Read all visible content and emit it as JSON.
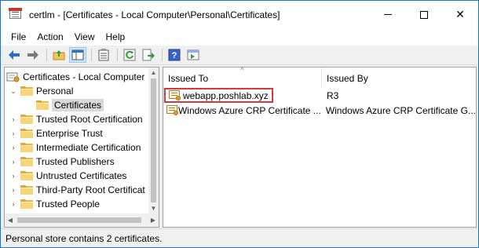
{
  "window": {
    "title": "certlm - [Certificates - Local Computer\\Personal\\Certificates]",
    "controls": {
      "minimize": "",
      "maximize": "",
      "close": "✕"
    }
  },
  "menu": {
    "items": [
      "File",
      "Action",
      "View",
      "Help"
    ]
  },
  "toolbar": {
    "buttons": [
      "back-arrow-icon",
      "forward-arrow-icon",
      "up-folder-icon",
      "show-hide-tree-icon",
      "export-list-icon",
      "refresh-icon",
      "export-icon",
      "help-icon",
      "properties-icon"
    ]
  },
  "tree": {
    "root": "Certificates - Local Computer",
    "items": [
      {
        "label": "Personal",
        "expanded": true
      },
      {
        "label": "Certificates",
        "selected": true
      },
      {
        "label": "Trusted Root Certification"
      },
      {
        "label": "Enterprise Trust"
      },
      {
        "label": "Intermediate Certification"
      },
      {
        "label": "Trusted Publishers"
      },
      {
        "label": "Untrusted Certificates"
      },
      {
        "label": "Third-Party Root Certificat"
      },
      {
        "label": "Trusted People"
      }
    ]
  },
  "list": {
    "columns": [
      "Issued To",
      "Issued By"
    ],
    "sort_indicator": "^",
    "rows": [
      {
        "issued_to": "webapp.poshlab.xyz",
        "issued_by": "R3",
        "highlighted": true
      },
      {
        "issued_to": "Windows Azure CRP Certificate ...",
        "issued_by": "Windows Azure CRP Certificate G..."
      }
    ]
  },
  "status": {
    "text": "Personal store contains 2 certificates."
  },
  "colors": {
    "window_border": "#1a73d9",
    "highlight_border": "#d9363e",
    "folder": "#f7d57a"
  }
}
